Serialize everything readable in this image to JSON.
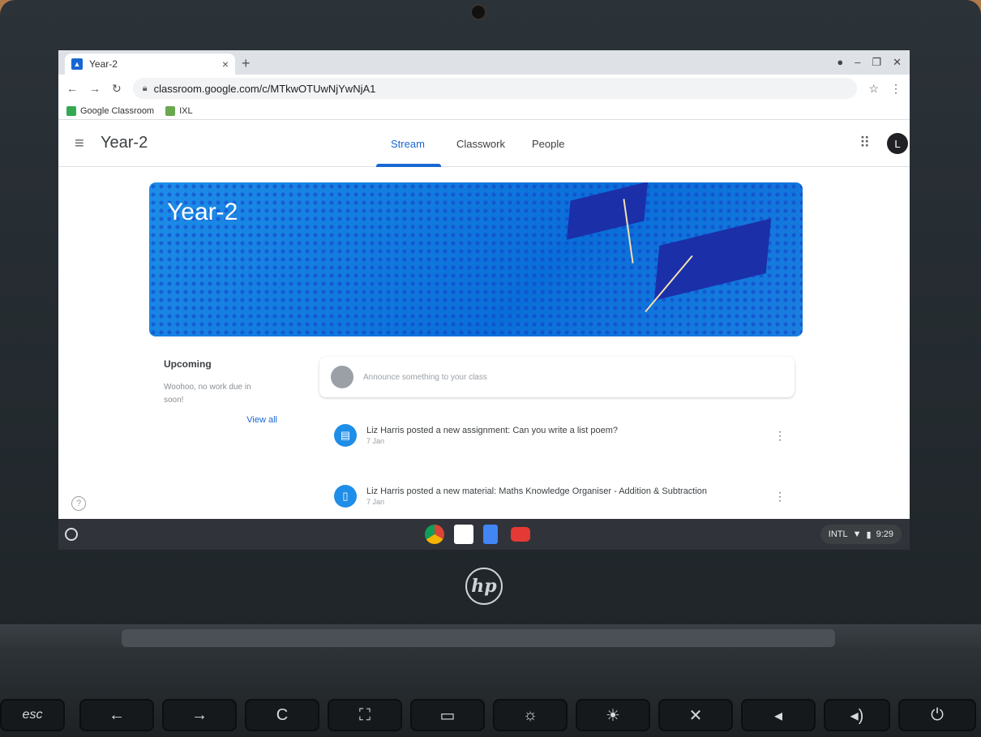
{
  "browser": {
    "tab_title": "Year-2",
    "tab_close": "×",
    "new_tab": "+",
    "url": "classroom.google.com/c/MTkwOTUwNjYwNjA1",
    "bookmarks": [
      {
        "label": "Google Classroom",
        "color": "#34a853"
      },
      {
        "label": "IXL",
        "color": "#6aa84f"
      }
    ]
  },
  "header": {
    "class_title": "Year-2",
    "tabs": [
      {
        "label": "Stream"
      },
      {
        "label": "Classwork"
      },
      {
        "label": "People"
      }
    ],
    "avatar_initial": "L"
  },
  "banner": {
    "title": "Year-2"
  },
  "upcoming": {
    "title": "Upcoming",
    "message": "Woohoo, no work due in soon!",
    "view_all": "View all"
  },
  "announce": {
    "placeholder": "Announce something to your class"
  },
  "stream": [
    {
      "title": "Liz Harris posted a new assignment: Can you write a list poem?",
      "date": "7 Jan"
    },
    {
      "title": "Liz Harris posted a new material: Maths Knowledge Organiser - Addition & Subtraction",
      "date": "7 Jan"
    }
  ],
  "tray": {
    "input": "INTL",
    "time": "9:29"
  },
  "keyboard": {
    "esc": "esc",
    "back": "←",
    "forward": "→",
    "refresh": "C"
  },
  "brand": "hp",
  "colors": {
    "accent": "#1967d2",
    "banner": "#1e8ee8"
  }
}
